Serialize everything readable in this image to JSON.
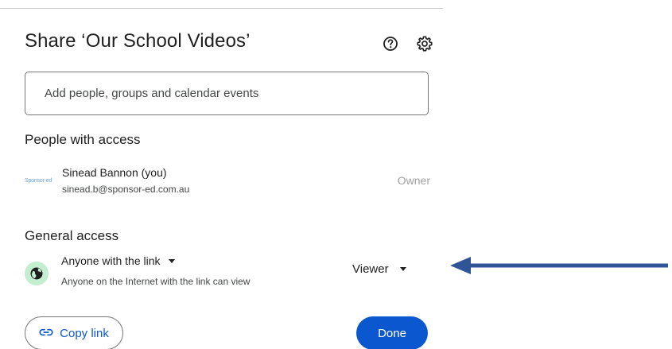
{
  "dialog": {
    "title": "Share ‘Our School Videos’"
  },
  "header_icons": {
    "help": "help-circle-icon",
    "settings": "gear-icon"
  },
  "add_people": {
    "placeholder": "Add people, groups and calendar events"
  },
  "people_with_access": {
    "heading": "People with access",
    "people": [
      {
        "logo_text": "Sponsor-ed",
        "name": "Sinead Bannon (you)",
        "email": "sinead.b@sponsor-ed.com.au",
        "role": "Owner"
      }
    ]
  },
  "general_access": {
    "heading": "General access",
    "scope": "Anyone with the link",
    "description": "Anyone on the Internet with the link can view",
    "role": "Viewer",
    "icon": "globe-icon"
  },
  "actions": {
    "copy_link": "Copy link",
    "done": "Done"
  },
  "colors": {
    "accent": "#0b57d0",
    "globe_bg": "#c4eed0",
    "annotation_arrow": "#2f5597"
  }
}
